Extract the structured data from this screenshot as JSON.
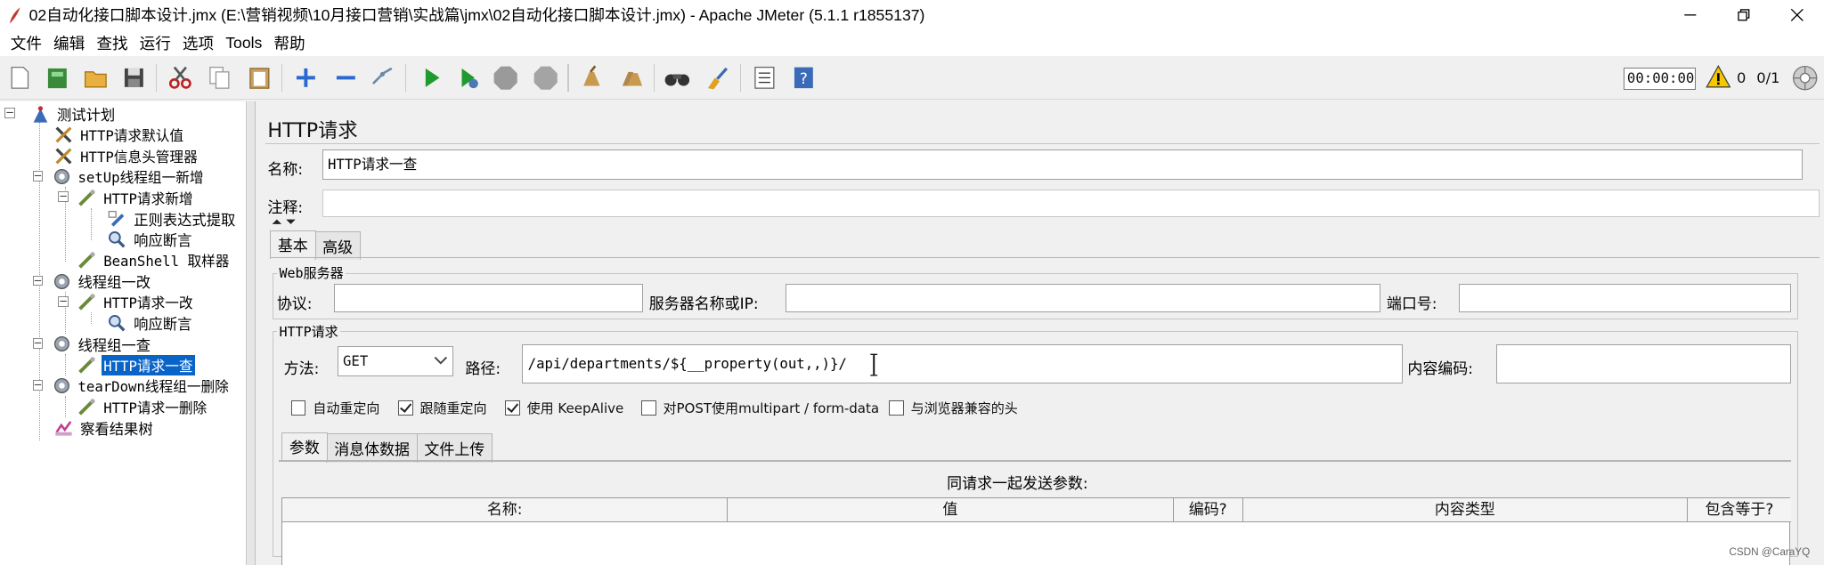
{
  "window": {
    "title": "02自动化接口脚本设计.jmx (E:\\营销视频\\10月接口营销\\实战篇\\jmx\\02自动化接口脚本设计.jmx) - Apache JMeter (5.1.1 r1855137)"
  },
  "menu": [
    "文件",
    "编辑",
    "查找",
    "运行",
    "选项",
    "Tools",
    "帮助"
  ],
  "toolbar": {
    "icons": [
      "new-icon",
      "templates-icon",
      "open-icon",
      "save-icon",
      "cut-icon",
      "copy-icon",
      "paste-icon",
      "expand-icon",
      "collapse-icon",
      "toggle-icon",
      "start-icon",
      "start-no-pause-icon",
      "stop-icon",
      "shutdown-icon",
      "clear-icon",
      "clear-all-icon",
      "search-icon",
      "reset-search-icon",
      "function-helper-icon",
      "help-icon"
    ],
    "timer": "00:00:00",
    "warning_count": "0",
    "threads": "0/1"
  },
  "tree": [
    {
      "label": "测试计划",
      "icon": "test-plan-icon"
    },
    {
      "label": "HTTP请求默认值",
      "icon": "config-icon"
    },
    {
      "label": "HTTP信息头管理器",
      "icon": "config-icon"
    },
    {
      "label": "setUp线程组一新增",
      "icon": "thread-group-icon"
    },
    {
      "label": "HTTP请求新增",
      "icon": "sampler-icon"
    },
    {
      "label": "正则表达式提取",
      "icon": "extractor-icon"
    },
    {
      "label": "响应断言",
      "icon": "assertion-icon"
    },
    {
      "label": "BeanShell 取样器",
      "icon": "sampler-icon"
    },
    {
      "label": "线程组一改",
      "icon": "thread-group-icon"
    },
    {
      "label": "HTTP请求一改",
      "icon": "sampler-icon"
    },
    {
      "label": "响应断言",
      "icon": "assertion-icon"
    },
    {
      "label": "线程组一查",
      "icon": "thread-group-icon"
    },
    {
      "label": "HTTP请求一查",
      "icon": "sampler-icon"
    },
    {
      "label": "tearDown线程组一删除",
      "icon": "thread-group-icon"
    },
    {
      "label": "HTTP请求一删除",
      "icon": "sampler-icon"
    },
    {
      "label": "察看结果树",
      "icon": "listener-icon"
    }
  ],
  "panel": {
    "title": "HTTP请求",
    "name_label": "名称:",
    "name_value": "HTTP请求一查",
    "comment_label": "注释:",
    "comment_value": "",
    "tabs": [
      "基本",
      "高级"
    ],
    "web_server": {
      "legend": "Web服务器",
      "protocol_label": "协议:",
      "protocol_value": "",
      "server_label": "服务器名称或IP:",
      "server_value": "",
      "port_label": "端口号:",
      "port_value": ""
    },
    "http_request": {
      "legend": "HTTP请求",
      "method_label": "方法:",
      "method_value": "GET",
      "path_label": "路径:",
      "path_value": "/api/departments/${__property(out,,)}/",
      "encoding_label": "内容编码:",
      "encoding_value": ""
    },
    "checkboxes": [
      {
        "label": "自动重定向",
        "checked": false
      },
      {
        "label": "跟随重定向",
        "checked": true
      },
      {
        "label": "使用 KeepAlive",
        "checked": true
      },
      {
        "label": "对POST使用multipart / form-data",
        "checked": false
      },
      {
        "label": "与浏览器兼容的头",
        "checked": false
      }
    ],
    "sub_tabs": [
      "参数",
      "消息体数据",
      "文件上传"
    ],
    "params_caption": "同请求一起发送参数:",
    "columns": [
      "名称:",
      "值",
      "编码?",
      "内容类型",
      "包含等于?"
    ]
  },
  "watermark": "CSDN @CaraYQ"
}
